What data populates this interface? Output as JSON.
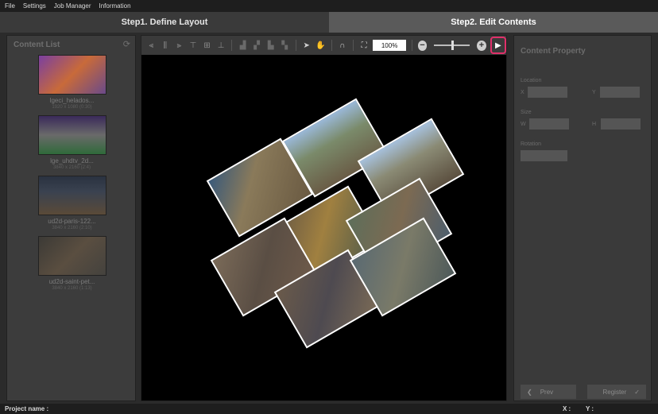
{
  "menu": [
    "File",
    "Settings",
    "Job Manager",
    "Information"
  ],
  "steps": {
    "step1": "Step1. Define Layout",
    "step2": "Step2. Edit Contents"
  },
  "content_list": {
    "title": "Content List",
    "items": [
      {
        "name": "lgeci_helados...",
        "dim": "1920 x 1080 (0:30)",
        "thumb_colors": [
          "#7a3fa0",
          "#c86a3a"
        ]
      },
      {
        "name": "lge_uhdtv_2d...",
        "dim": "3840 x 2160 (2:4)",
        "thumb_colors": [
          "#3a2a5a",
          "#2f6a3a"
        ]
      },
      {
        "name": "ud2d-paris-122...",
        "dim": "3840 x 2160 (2:10)",
        "thumb_colors": [
          "#2a3240",
          "#5a4a38"
        ]
      },
      {
        "name": "ud2d-saint-pet...",
        "dim": "3840 x 2160 (1:13)",
        "thumb_colors": [
          "#3c3a36",
          "#5a4e40"
        ]
      }
    ]
  },
  "toolbar": {
    "zoom_value": "100%",
    "zoom_out": "−",
    "zoom_in": "+",
    "play": "▶"
  },
  "property": {
    "title": "Content Property",
    "location_label": "Location",
    "x_label": "X",
    "y_label": "Y",
    "size_label": "Size",
    "w_label": "W",
    "h_label": "H",
    "rotation_label": "Rotation",
    "prev_label": "Prev",
    "register_label": "Register"
  },
  "status": {
    "project_label": "Project name :",
    "x_label": "X :",
    "y_label": "Y :"
  },
  "colors": {
    "accent": "#e0306a"
  }
}
